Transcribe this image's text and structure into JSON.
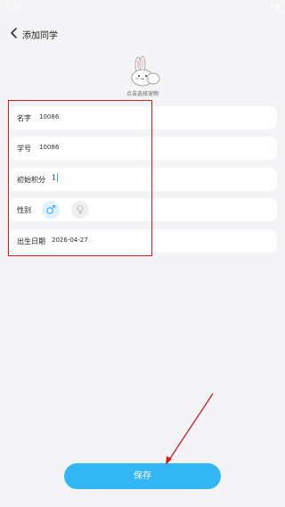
{
  "status_bar": {
    "time": "5:33",
    "icons_text": "▾ ▮"
  },
  "header": {
    "title": "添加同学",
    "back_icon": "chevron-left-icon"
  },
  "pet": {
    "caption": "点击选择宠物",
    "icon": "bunny-pet-icon"
  },
  "form": {
    "name": {
      "label": "名字",
      "value": "10086"
    },
    "student_id": {
      "label": "学号",
      "value": "10086"
    },
    "initial_points": {
      "label": "初始积分",
      "value": "1"
    },
    "gender": {
      "label": "性别",
      "male_icon": "male-icon",
      "female_icon": "female-icon",
      "selected": "male"
    },
    "birthdate": {
      "label": "出生日期",
      "value": "2026-04-27"
    }
  },
  "save_button": {
    "label": "保存"
  },
  "colors": {
    "accent": "#33b7f4",
    "highlight": "#e51b1b",
    "background": "#f4f4f6"
  }
}
